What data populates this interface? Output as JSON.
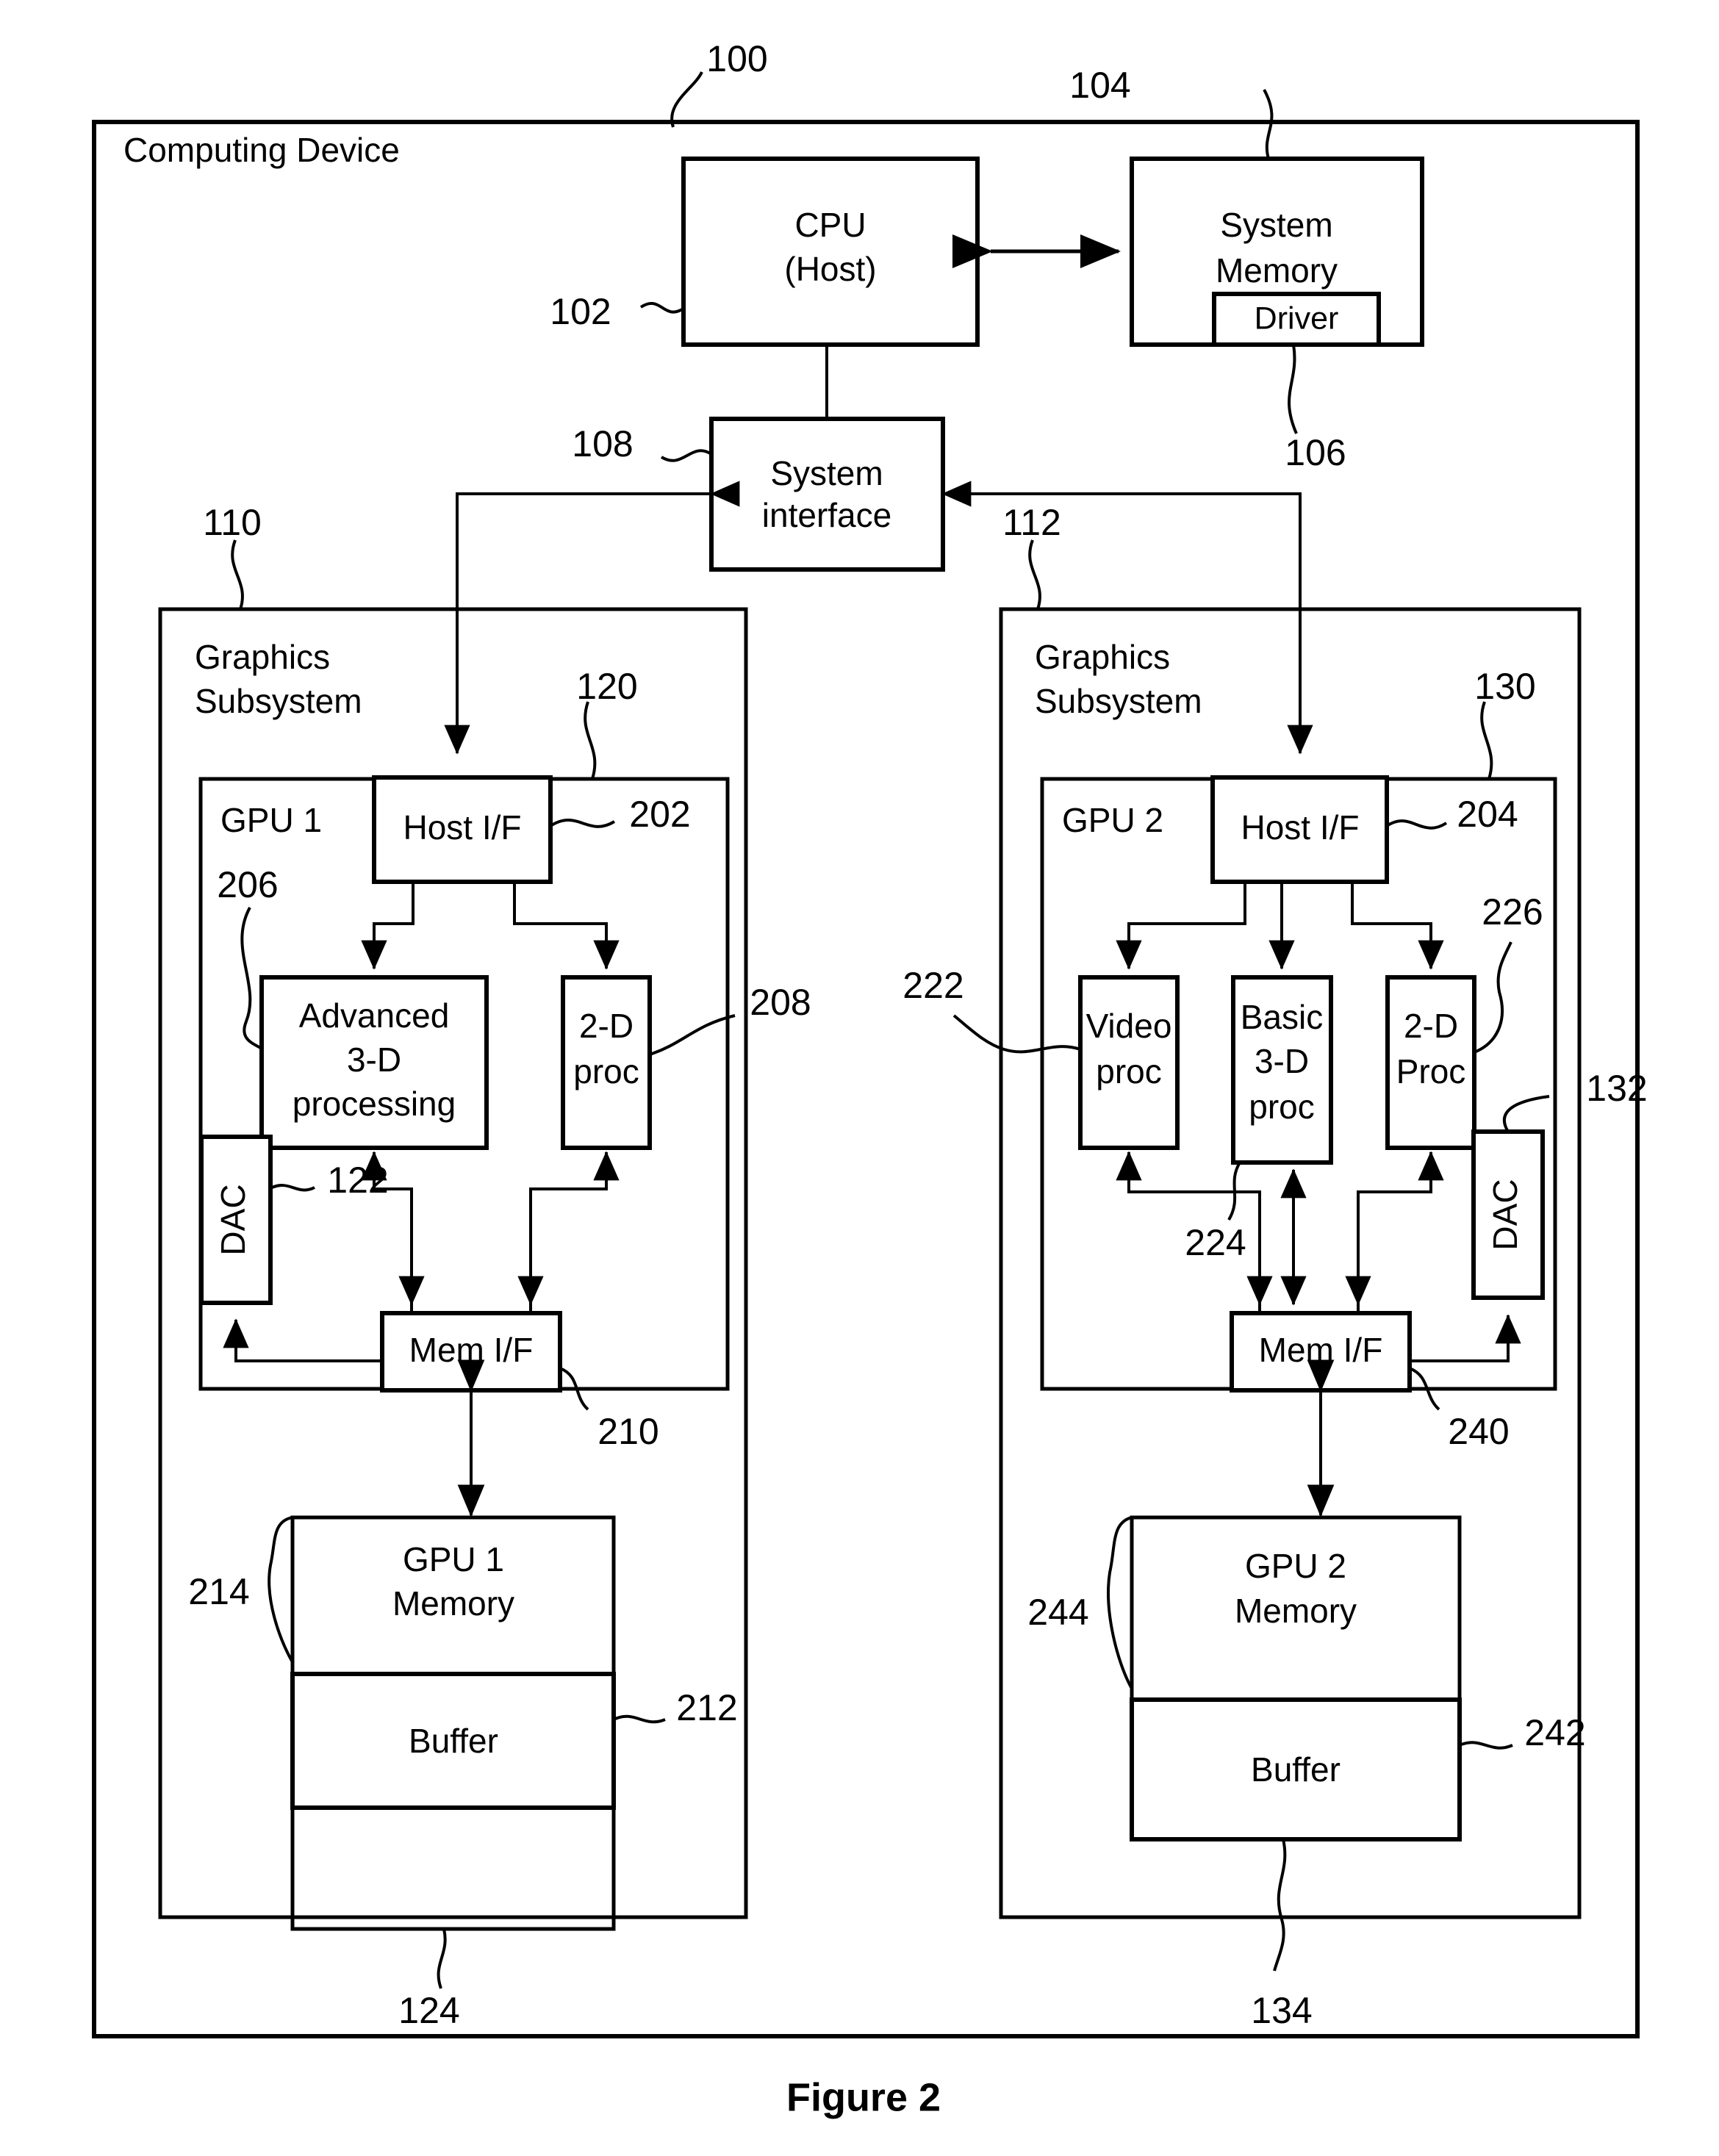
{
  "figure": {
    "caption": "Figure 2"
  },
  "diagram": {
    "type": "block-diagram",
    "outer": {
      "label": "Computing Device",
      "ref": "100"
    },
    "blocks": {
      "cpu": {
        "line1": "CPU",
        "line2": "(Host)",
        "ref": "102"
      },
      "system_memory": {
        "line1": "System",
        "line2": "Memory",
        "ref": "104"
      },
      "driver": {
        "label": "Driver",
        "ref": "106"
      },
      "system_interface": {
        "line1": "System",
        "line2": "interface",
        "ref": "108"
      },
      "gfx_subsystem_left": {
        "line1": "Graphics",
        "line2": "Subsystem",
        "ref": "110"
      },
      "gfx_subsystem_right": {
        "line1": "Graphics",
        "line2": "Subsystem",
        "ref": "112"
      },
      "gpu1": {
        "label": "GPU 1",
        "ref": "120"
      },
      "gpu2": {
        "label": "GPU 2",
        "ref": "130"
      },
      "host_if_1": {
        "label": "Host I/F",
        "ref": "202"
      },
      "host_if_2": {
        "label": "Host I/F",
        "ref": "204"
      },
      "advanced_3d": {
        "line1": "Advanced",
        "line2": "3-D",
        "line3": "processing",
        "ref": "206"
      },
      "two_d_proc_1": {
        "line1": "2-D",
        "line2": "proc",
        "ref": "208"
      },
      "video_proc": {
        "line1": "Video",
        "line2": "proc",
        "ref": "222"
      },
      "basic_3d_proc": {
        "line1": "Basic",
        "line2": "3-D",
        "line3": "proc",
        "ref": "224"
      },
      "two_d_proc_2": {
        "line1": "2-D",
        "line2": "Proc",
        "ref": "226"
      },
      "dac_1": {
        "label": "DAC",
        "ref": "122"
      },
      "dac_2": {
        "label": "DAC",
        "ref": "132"
      },
      "mem_if_1": {
        "label": "Mem I/F",
        "ref": "210"
      },
      "mem_if_2": {
        "label": "Mem I/F",
        "ref": "240"
      },
      "gpu1_memory": {
        "line1": "GPU 1",
        "line2": "Memory",
        "ref": "214"
      },
      "gpu2_memory": {
        "line1": "GPU 2",
        "line2": "Memory",
        "ref": "244"
      },
      "buffer_1": {
        "label": "Buffer",
        "ref": "212"
      },
      "buffer_2": {
        "label": "Buffer",
        "ref": "242"
      },
      "mem_region_1": {
        "label": "",
        "ref": "124"
      },
      "mem_region_2": {
        "label": "",
        "ref": "134"
      }
    },
    "reference_numerals": [
      "100",
      "102",
      "104",
      "106",
      "108",
      "110",
      "112",
      "120",
      "122",
      "124",
      "130",
      "132",
      "134",
      "202",
      "204",
      "206",
      "208",
      "210",
      "212",
      "214",
      "222",
      "224",
      "226",
      "240",
      "242",
      "244"
    ]
  }
}
